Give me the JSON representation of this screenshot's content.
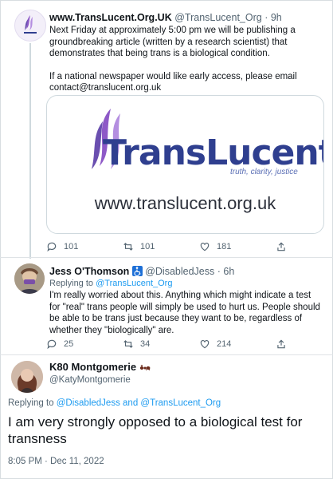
{
  "tweet1": {
    "display_name": "www.TransLucent.Org.UK",
    "handle": "@TransLucent_Org",
    "separator": "·",
    "time": "9h",
    "avatar_label": "TransLucent",
    "text_para1": "Next Friday at approximately 5:00 pm we will be publishing a groundbreaking article (written by a research scientist) that demonstrates that being trans is a biological condition.",
    "text_para2": "If a national newspaper would like early access, please email contact@translucent.org.uk",
    "card": {
      "wordmark": "TransLucent",
      "tagline": "truth, clarity, justice",
      "url": "www.translucent.org.uk"
    },
    "actions": {
      "replies": "101",
      "retweets": "101",
      "likes": "181"
    }
  },
  "tweet2": {
    "display_name": "Jess O'Thomson",
    "badge": "accessibility-icon",
    "handle": "@DisabledJess",
    "separator": "·",
    "time": "6h",
    "reply_prefix": "Replying to",
    "reply_to": "@TransLucent_Org",
    "text": "I'm really worried about this. Anything which might indicate a test for \"real\" trans people will simply be used to hurt us. People should be able to be trans just because they want to be, regardless of whether they \"biologically\" are.",
    "actions": {
      "replies": "25",
      "retweets": "34",
      "likes": "214"
    }
  },
  "tweet3": {
    "display_name": "K80 Montgomerie",
    "badge": "ant-emoji",
    "handle": "@KatyMontgomerie",
    "reply_prefix": "Replying to",
    "reply_to_1": "@DisabledJess",
    "reply_and": "and",
    "reply_to_2": "@TransLucent_Org",
    "text": "I am very strongly opposed to a biological test for transness",
    "timestamp": "8:05 PM · Dec 11, 2022"
  },
  "colors": {
    "link": "#1d9bf0",
    "secondary_text": "#536471",
    "brand_blue": "#2f3f8f",
    "brand_purple": "#8e59c7"
  }
}
